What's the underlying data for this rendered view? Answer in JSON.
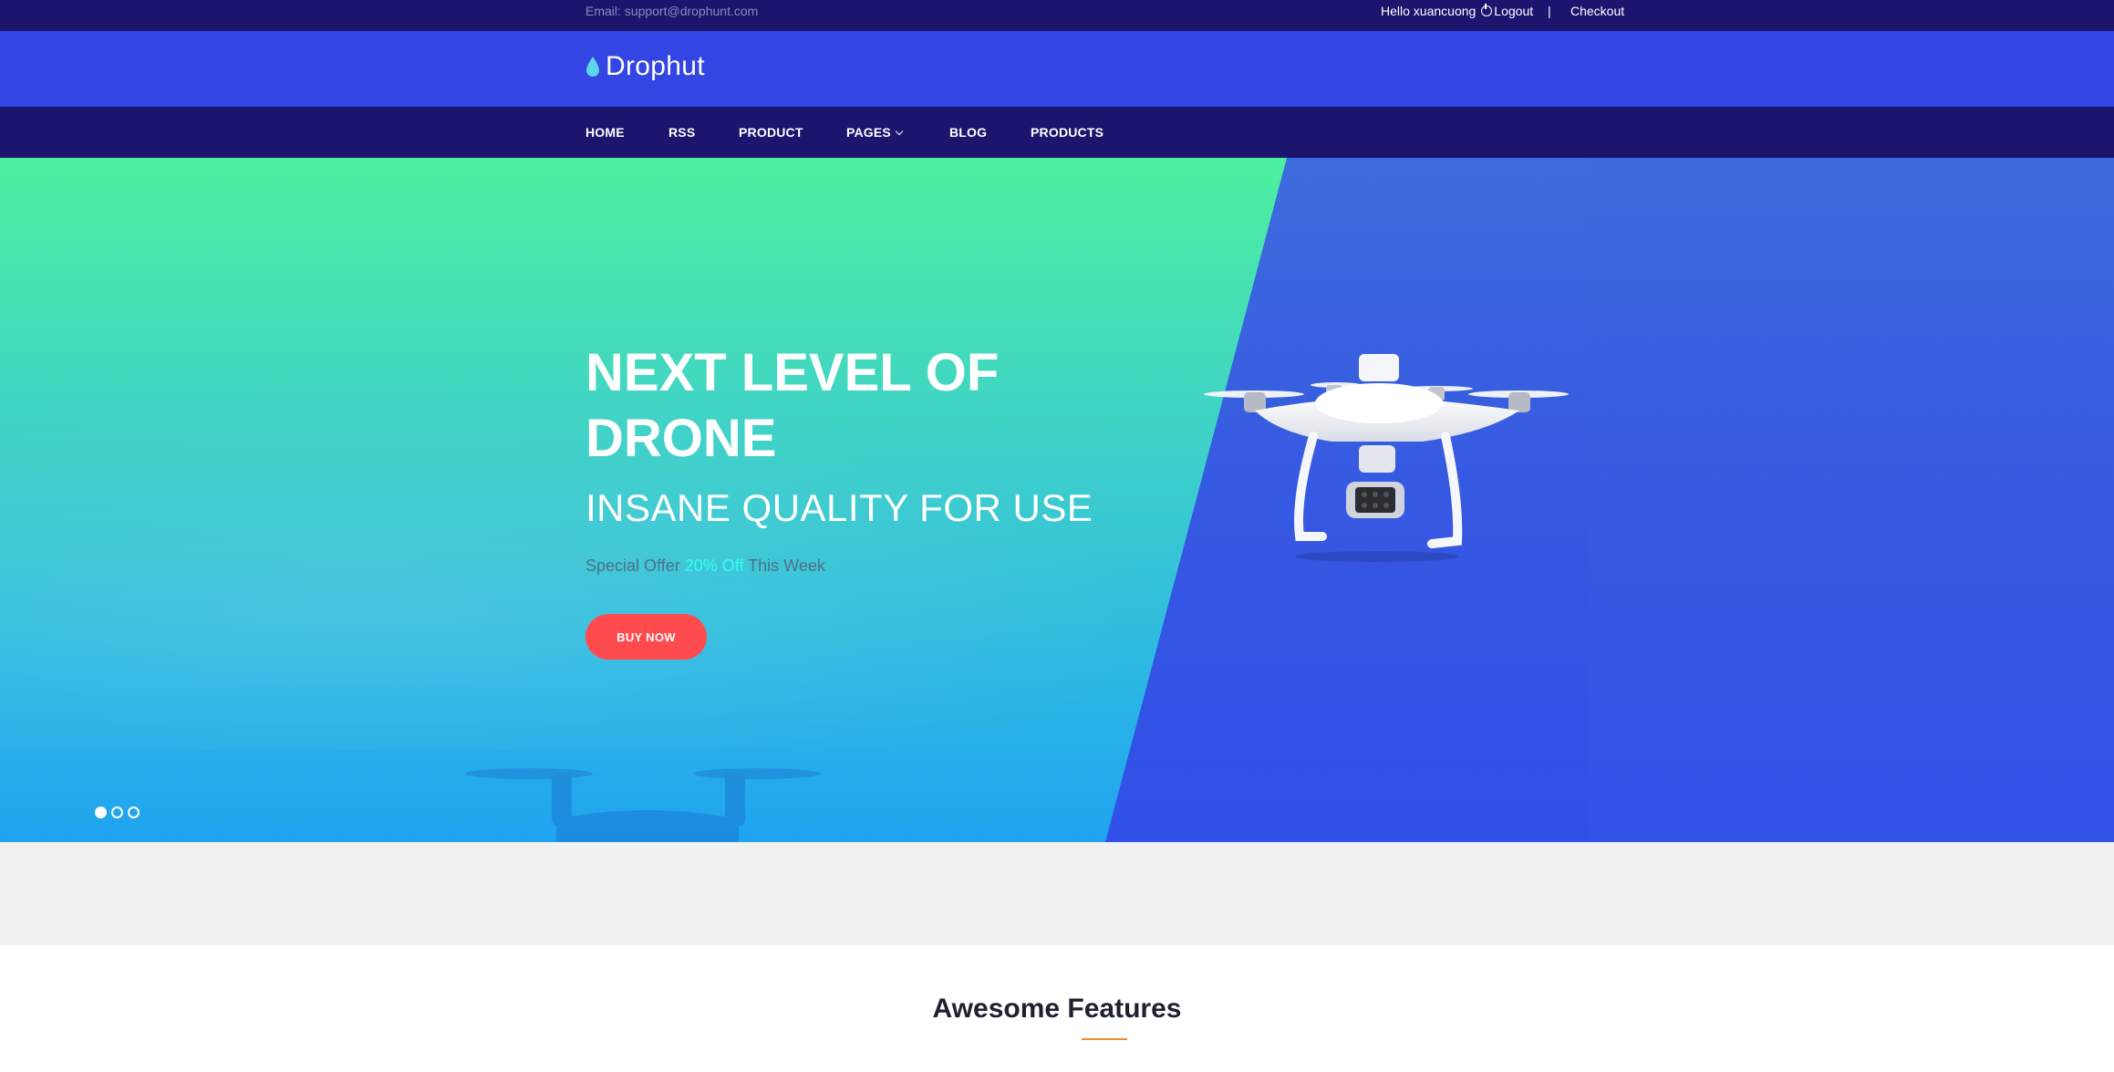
{
  "topbar": {
    "email": "Email: support@drophunt.com",
    "greeting": "Hello xuancuong",
    "logout": "Logout",
    "separator": "|",
    "checkout": "Checkout"
  },
  "brand": {
    "name": "Drophut",
    "icon": "water-drop-icon"
  },
  "nav": {
    "items": [
      {
        "label": "HOME"
      },
      {
        "label": "RSS"
      },
      {
        "label": "PRODUCT"
      },
      {
        "label": "PAGES",
        "dropdown": true
      },
      {
        "label": "BLOG"
      },
      {
        "label": "PRODUCTS"
      }
    ]
  },
  "hero": {
    "title": "NEXT LEVEL OF DRONE",
    "subtitle": "INSANE QUALITY FOR USE",
    "offer_prefix": "Special Offer",
    "offer_highlight": "20% Off",
    "offer_suffix": "This Week",
    "cta": "BUY NOW",
    "slides": 3,
    "active_slide": 1
  },
  "features": {
    "title": "Awesome Features"
  },
  "colors": {
    "topbar": "#1b156e",
    "brandbar": "#3346e3",
    "accent_cta": "#ff4b4e",
    "highlight": "#33fff5",
    "underline": "#f08a2c"
  }
}
